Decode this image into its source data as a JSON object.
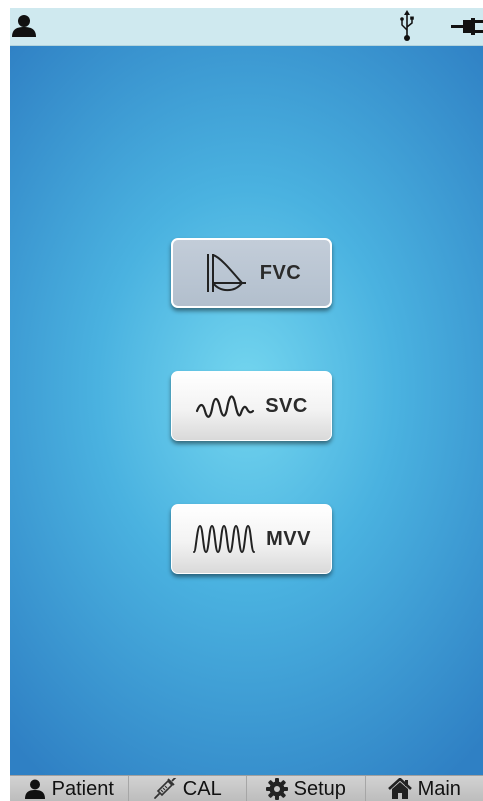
{
  "status_bar": {
    "icons": [
      "user-icon",
      "usb-icon",
      "power-plug-icon"
    ]
  },
  "modes": [
    {
      "label": "FVC",
      "icon": "fvc-curve-icon",
      "selected": true
    },
    {
      "label": "SVC",
      "icon": "svc-wave-icon",
      "selected": false
    },
    {
      "label": "MVV",
      "icon": "mvv-wave-icon",
      "selected": false
    }
  ],
  "tab_bar": {
    "tabs": [
      {
        "label": "Patient",
        "icon": "user-icon"
      },
      {
        "label": "CAL",
        "icon": "syringe-icon"
      },
      {
        "label": "Setup",
        "icon": "gear-icon"
      },
      {
        "label": "Main",
        "icon": "home-icon"
      }
    ]
  },
  "colors": {
    "status_bar_bg": "#cfe9ef",
    "background_center": "#74d6ef",
    "background_edge": "#2f80c4",
    "selected_button": "#b9c5d2",
    "tab_bar_bg": "#c8c8c8"
  }
}
